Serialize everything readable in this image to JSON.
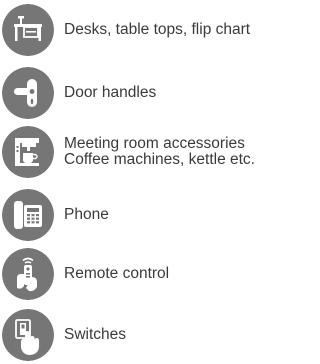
{
  "colors": {
    "icon_background": "#767676",
    "icon_foreground": "#ffffff",
    "text": "#3a3a3a"
  },
  "items": [
    {
      "icon": "desk-icon",
      "lines": [
        "Desks, table tops, flip chart"
      ]
    },
    {
      "icon": "door-handle-icon",
      "lines": [
        "Door handles"
      ]
    },
    {
      "icon": "coffee-machine-icon",
      "lines": [
        "Meeting room accessories",
        "Coffee machines, kettle etc."
      ]
    },
    {
      "icon": "phone-icon",
      "lines": [
        "Phone"
      ]
    },
    {
      "icon": "remote-control-icon",
      "lines": [
        "Remote control"
      ]
    },
    {
      "icon": "switch-icon",
      "lines": [
        "Switches"
      ]
    }
  ]
}
